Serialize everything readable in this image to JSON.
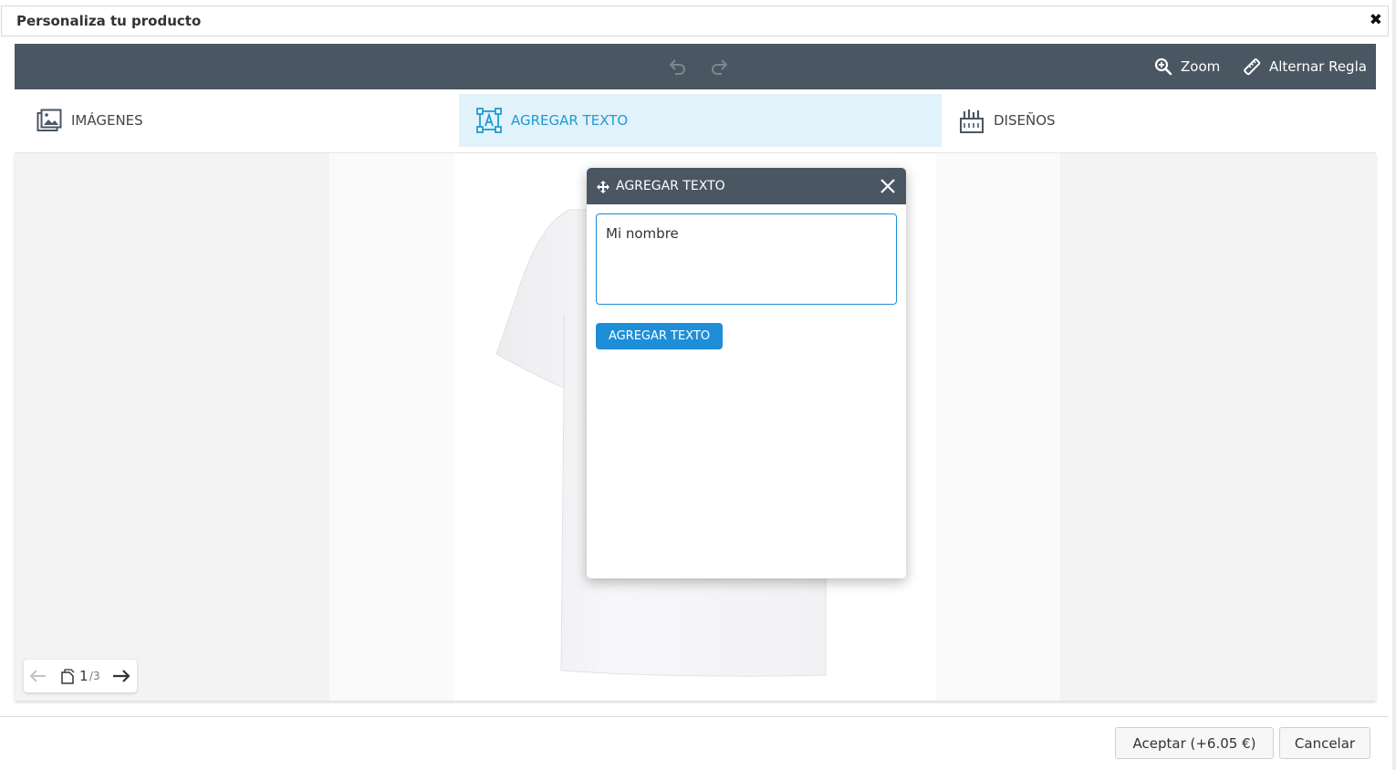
{
  "modal": {
    "title": "Personaliza tu producto",
    "close_glyph": "✖"
  },
  "toolbar": {
    "undo_icon": "undo-icon",
    "redo_icon": "redo-icon",
    "zoom_label": "Zoom",
    "ruler_label": "Alternar Regla"
  },
  "tabs": [
    {
      "label": "IMÁGENES",
      "icon": "images-icon",
      "active": false
    },
    {
      "label": "AGREGAR TEXTO",
      "icon": "text-frame-icon",
      "active": true
    },
    {
      "label": "DISEÑOS",
      "icon": "designs-icon",
      "active": false
    }
  ],
  "dialog": {
    "title": "AGREGAR TEXTO",
    "text_value": "Mi nombre",
    "button_label": "AGREGAR TEXTO"
  },
  "pager": {
    "current": "1",
    "total": "/3"
  },
  "footer": {
    "accept_label": "Aceptar (+6.05 €)",
    "cancel_label": "Cancelar"
  },
  "colors": {
    "toolbar": "#4a5662",
    "accent": "#1e9bd2",
    "active_tab_bg": "#e2f2fa",
    "primary_button": "#1e8ed8"
  }
}
